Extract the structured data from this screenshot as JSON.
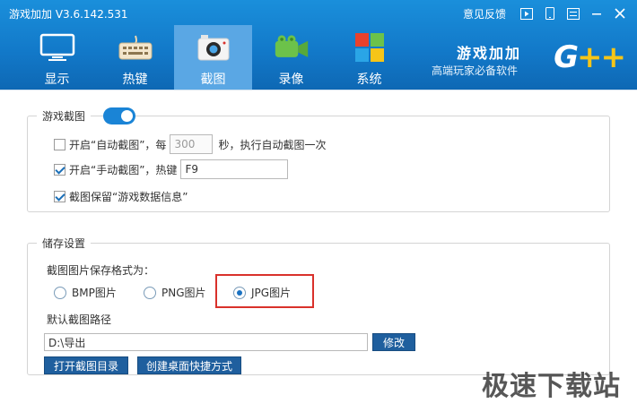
{
  "window": {
    "title": "游戏加加 V3.6.142.531",
    "feedback_label": "意见反馈"
  },
  "nav": {
    "items": [
      {
        "label": "显示",
        "icon": "monitor-icon",
        "active": false
      },
      {
        "label": "热键",
        "icon": "keyboard-icon",
        "active": false
      },
      {
        "label": "截图",
        "icon": "camera-icon",
        "active": true
      },
      {
        "label": "录像",
        "icon": "video-camera-icon",
        "active": false
      },
      {
        "label": "系统",
        "icon": "system-grid-icon",
        "active": false
      }
    ]
  },
  "brand": {
    "title": "游戏加加",
    "subtitle": "高端玩家必备软件",
    "logo_g": "G",
    "logo_plus": "++"
  },
  "screenshot_group": {
    "legend": "游戏截图",
    "enabled": true,
    "auto": {
      "checked": false,
      "label_prefix": "开启“自动截图”，每",
      "interval_value": "300",
      "label_suffix": "秒，执行自动截图一次"
    },
    "manual": {
      "checked": true,
      "label": "开启“手动截图”，热键",
      "hotkey_value": "F9"
    },
    "keep_info": {
      "checked": true,
      "label": "截图保留“游戏数据信息”"
    }
  },
  "storage_group": {
    "legend": "储存设置",
    "format_label": "截图图片保存格式为：",
    "formats": [
      {
        "label": "BMP图片",
        "selected": false
      },
      {
        "label": "PNG图片",
        "selected": false
      },
      {
        "label": "JPG图片",
        "selected": true
      }
    ],
    "path_label": "默认截图路径",
    "path_value": "D:\\导出",
    "modify_button": "修改",
    "open_dir_button": "打开截图目录",
    "shortcut_button": "创建桌面快捷方式"
  },
  "watermark": "极速下载站",
  "colors": {
    "header_blue": "#1278c8",
    "active_tab": "#5aa7e4",
    "button_blue": "#1f5f9e",
    "highlight_red": "#d9312b",
    "accent_yellow": "#f5c518"
  }
}
